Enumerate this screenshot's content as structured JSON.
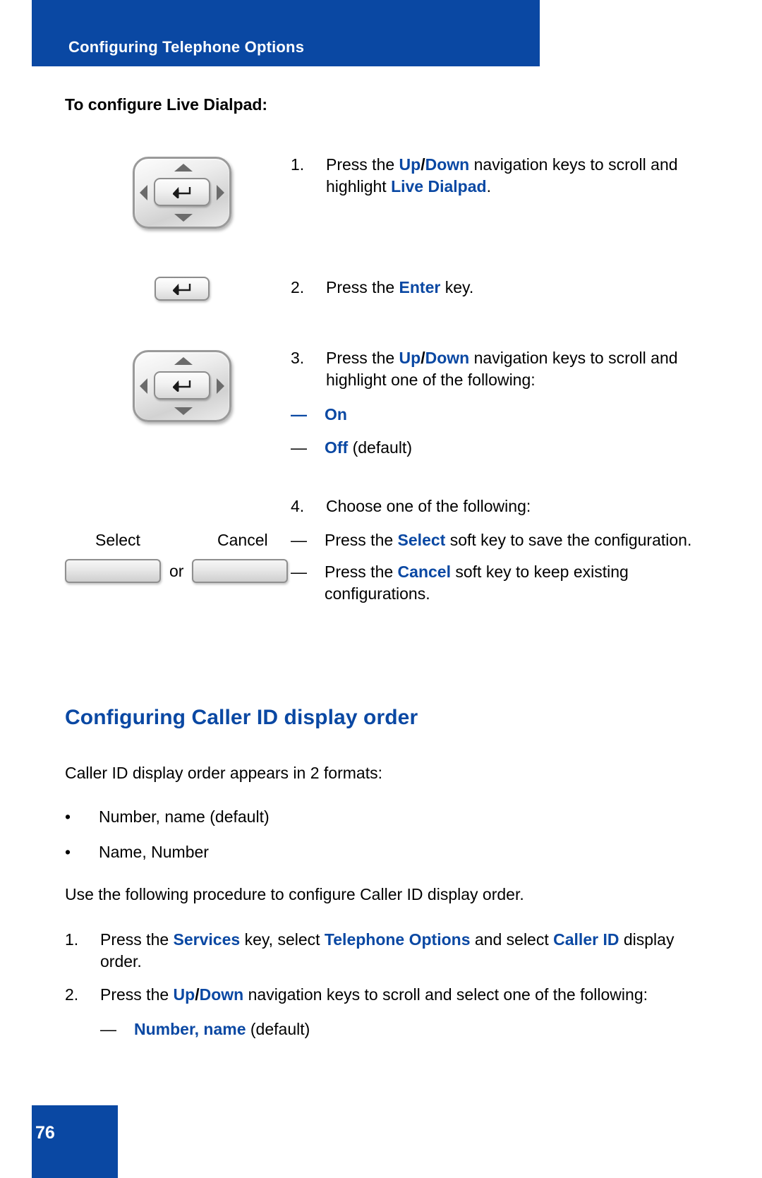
{
  "colors": {
    "brand_blue": "#0a48a3",
    "text_black": "#000000",
    "page_white": "#ffffff"
  },
  "header": {
    "title": "Configuring Telephone Options"
  },
  "section": {
    "title": "To configure Live Dialpad:"
  },
  "steps": [
    {
      "number": "1.",
      "icon": "navigation-keys-icon",
      "text_parts": [
        {
          "t": "Press the ",
          "style": "plain"
        },
        {
          "t": "Up",
          "style": "blue-bold"
        },
        {
          "t": "/",
          "style": "black-bold"
        },
        {
          "t": "Down",
          "style": "blue-bold"
        },
        {
          "t": " navigation keys to scroll and highlight ",
          "style": "plain"
        },
        {
          "t": "Live Dialpad",
          "style": "blue-bold"
        },
        {
          "t": ".",
          "style": "plain"
        }
      ]
    },
    {
      "number": "2.",
      "icon": "enter-key-icon",
      "text_parts": [
        {
          "t": "Press the ",
          "style": "plain"
        },
        {
          "t": "Enter",
          "style": "blue-bold"
        },
        {
          "t": " key.",
          "style": "plain"
        }
      ]
    },
    {
      "number": "3.",
      "icon": "navigation-keys-icon",
      "text_parts": [
        {
          "t": "Press the ",
          "style": "plain"
        },
        {
          "t": "Up",
          "style": "blue-bold"
        },
        {
          "t": "/",
          "style": "black-bold"
        },
        {
          "t": "Down",
          "style": "blue-bold"
        },
        {
          "t": " navigation keys to scroll and highlight one of the following:",
          "style": "plain"
        }
      ]
    },
    {
      "number": "4.",
      "icon": "soft-keys-icon",
      "text_parts": [
        {
          "t": "Choose one of the following:",
          "style": "plain"
        }
      ]
    }
  ],
  "step3_options": [
    {
      "dash": "—",
      "dash_color": "blue",
      "label": "On",
      "suffix": ""
    },
    {
      "dash": "—",
      "dash_color": "black",
      "label": "Off",
      "suffix": " (default)"
    }
  ],
  "step4_options": [
    {
      "dash": "—",
      "parts": [
        {
          "t": "Press the ",
          "style": "plain"
        },
        {
          "t": "Select",
          "style": "blue-bold"
        },
        {
          "t": " soft key to save the configuration.",
          "style": "plain"
        }
      ]
    },
    {
      "dash": "—",
      "parts": [
        {
          "t": "Press the ",
          "style": "plain"
        },
        {
          "t": "Cancel",
          "style": "blue-bold"
        },
        {
          "t": " soft key to keep existing configurations.",
          "style": "plain"
        }
      ]
    }
  ],
  "softkeys": {
    "first_label": "Select",
    "second_label": "Cancel",
    "separator": "or"
  },
  "caller_id_section": {
    "heading": "Configuring Caller ID display order",
    "intro": "Caller ID display order appears in 2 formats:",
    "bullets": [
      {
        "dot": "•",
        "text": "Number, name (default)"
      },
      {
        "dot": "•",
        "text": "Name, Number"
      }
    ],
    "procedure_intro": "Use the following procedure to configure Caller ID display order.",
    "steps": [
      {
        "number": "1.",
        "parts": [
          {
            "t": "Press the ",
            "style": "plain"
          },
          {
            "t": "Services",
            "style": "blue-bold"
          },
          {
            "t": " key, select ",
            "style": "plain"
          },
          {
            "t": "Telephone Options",
            "style": "blue-bold"
          },
          {
            "t": " and select ",
            "style": "plain"
          },
          {
            "t": "Caller ID",
            "style": "blue-bold"
          },
          {
            "t": " display order.",
            "style": "plain"
          }
        ]
      },
      {
        "number": "2.",
        "parts": [
          {
            "t": "Press the ",
            "style": "plain"
          },
          {
            "t": "Up",
            "style": "blue-bold"
          },
          {
            "t": "/",
            "style": "black-bold"
          },
          {
            "t": "Down",
            "style": "blue-bold"
          },
          {
            "t": " navigation keys to scroll and select one of the following:",
            "style": "plain"
          }
        ]
      }
    ],
    "step2_options": [
      {
        "dash": "—",
        "label": "Number, name",
        "suffix": " (default)"
      }
    ]
  },
  "footer": {
    "page_number": "76"
  }
}
